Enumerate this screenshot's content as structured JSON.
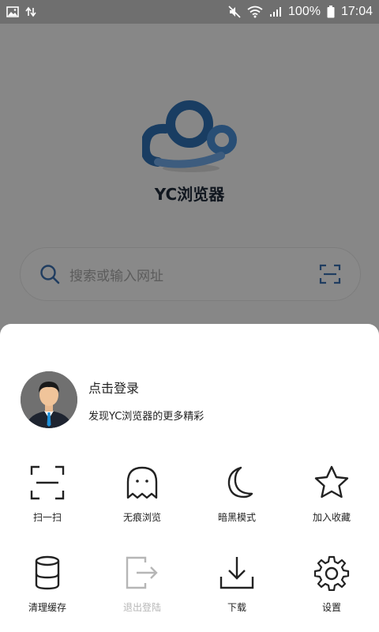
{
  "status_bar": {
    "battery": "100%",
    "time": "17:04",
    "icons": [
      "image-icon",
      "sync-arrows-icon",
      "mute-icon",
      "wifi-icon",
      "signal-icon",
      "battery-icon"
    ]
  },
  "home": {
    "app_name": "YC浏览器",
    "search_placeholder": "搜索或输入网址",
    "brand_color": "#2f6fb3"
  },
  "sheet": {
    "login_title": "点击登录",
    "login_subtitle": "发现YC浏览器的更多精彩",
    "actions": [
      {
        "label": "扫一扫",
        "icon": "scan-icon"
      },
      {
        "label": "无痕浏览",
        "icon": "ghost-icon"
      },
      {
        "label": "暗黑模式",
        "icon": "moon-icon"
      },
      {
        "label": "加入收藏",
        "icon": "star-icon"
      },
      {
        "label": "清理缓存",
        "icon": "database-icon"
      },
      {
        "label": "退出登陆",
        "icon": "logout-icon",
        "disabled": true
      },
      {
        "label": "下载",
        "icon": "download-icon"
      },
      {
        "label": "设置",
        "icon": "gear-icon"
      }
    ]
  }
}
